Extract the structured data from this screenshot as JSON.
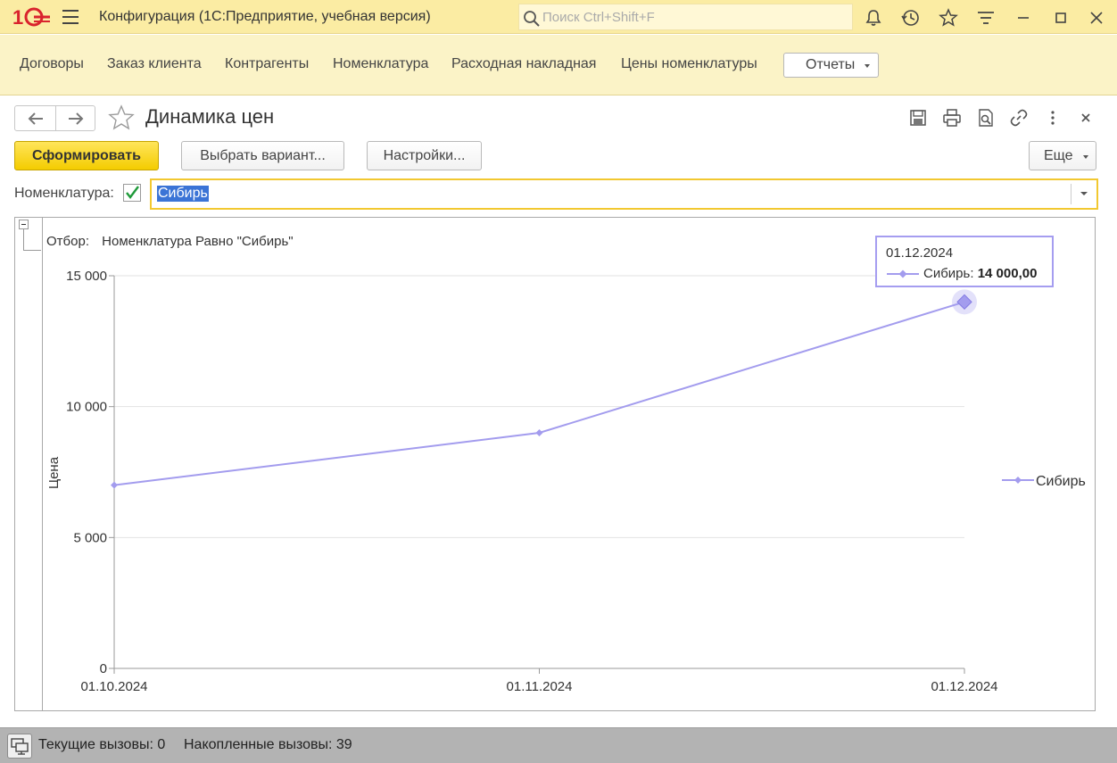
{
  "titlebar": {
    "app_title": "Конфигурация  (1С:Предприятие, учебная версия)",
    "search_placeholder": "Поиск Ctrl+Shift+F"
  },
  "sections": {
    "items": [
      "Договоры",
      "Заказ клиента",
      "Контрагенты",
      "Номенклатура",
      "Расходная накладная",
      "Цены номенклатуры"
    ],
    "reports_label": "Отчеты"
  },
  "form": {
    "title": "Динамика цен",
    "generate_label": "Сформировать",
    "variant_label": "Выбрать вариант...",
    "settings_label": "Настройки...",
    "more_label": "Еще",
    "field_label": "Номенклатура:",
    "field_checked": true,
    "field_value": "Сибирь"
  },
  "report": {
    "filter_caption": "Отбор:",
    "filter_value": "Номенклатура Равно \"Сибирь\"",
    "tooltip": {
      "date": "01.12.2024",
      "series": "Сибирь:",
      "value": "14 000,00"
    }
  },
  "chart_data": {
    "type": "line",
    "categories": [
      "01.10.2024",
      "01.11.2024",
      "01.12.2024"
    ],
    "series": [
      {
        "name": "Сибирь",
        "values": [
          7000,
          9000,
          14000
        ],
        "color": "#a39cee"
      }
    ],
    "ylabel": "Цена",
    "xlabel": "",
    "ylim": [
      0,
      15000
    ],
    "yticks": [
      0,
      5000,
      10000,
      15000
    ],
    "ytick_labels": [
      "0",
      "5 000",
      "10 000",
      "15 000"
    ],
    "grid": true,
    "legend_position": "right"
  },
  "statusbar": {
    "current_calls": "Текущие вызовы: 0",
    "accumulated_calls": "Накопленные вызовы: 39"
  },
  "colors": {
    "titlebar_bg": "#fbeca3",
    "sections_bg": "#fbf3c7",
    "primary_button": "#f4cc00",
    "series_color": "#a39cee",
    "selection": "#3b74d6"
  }
}
